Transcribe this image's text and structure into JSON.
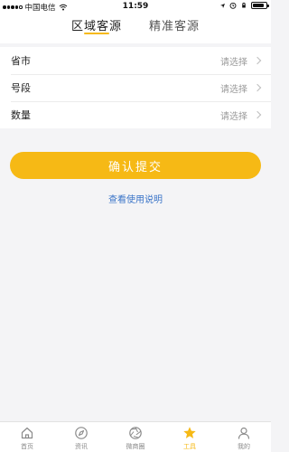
{
  "status_bar": {
    "carrier": "中国电信",
    "time": "11:59",
    "signal_bars": 4,
    "battery_level": 0.9
  },
  "tabs": [
    {
      "label": "区域客源",
      "active": true
    },
    {
      "label": "精准客源",
      "active": false
    }
  ],
  "form": {
    "rows": [
      {
        "label": "省市",
        "value": "请选择"
      },
      {
        "label": "号段",
        "value": "请选择"
      },
      {
        "label": "数量",
        "value": "请选择"
      }
    ]
  },
  "submit": {
    "label": "确认提交"
  },
  "help": {
    "label": "查看使用说明"
  },
  "bottom_nav": {
    "items": [
      {
        "label": "首页",
        "icon": "home-icon",
        "active": false
      },
      {
        "label": "资讯",
        "icon": "compass-icon",
        "active": false
      },
      {
        "label": "微商圈",
        "icon": "aperture-icon",
        "active": false
      },
      {
        "label": "工具",
        "icon": "star-icon",
        "active": true
      },
      {
        "label": "我的",
        "icon": "user-icon",
        "active": false
      }
    ]
  },
  "colors": {
    "accent": "#f6b915",
    "link": "#3a74c8",
    "background": "#f4f4f6",
    "inactive_icon": "#8a8a8a"
  }
}
